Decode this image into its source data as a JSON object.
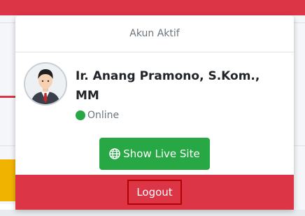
{
  "dropdown": {
    "header": "Akun Aktif",
    "user": {
      "name": "Ir. Anang Pramono, S.Kom., MM",
      "status": "Online",
      "status_color": "#28a745"
    },
    "live_site_button": {
      "label": "Show Live Site",
      "icon": "globe-icon"
    },
    "logout_button": {
      "label": "Logout"
    }
  },
  "colors": {
    "accent_red": "#dc3545",
    "success_green": "#28a745",
    "warning_yellow": "#f0b400"
  }
}
